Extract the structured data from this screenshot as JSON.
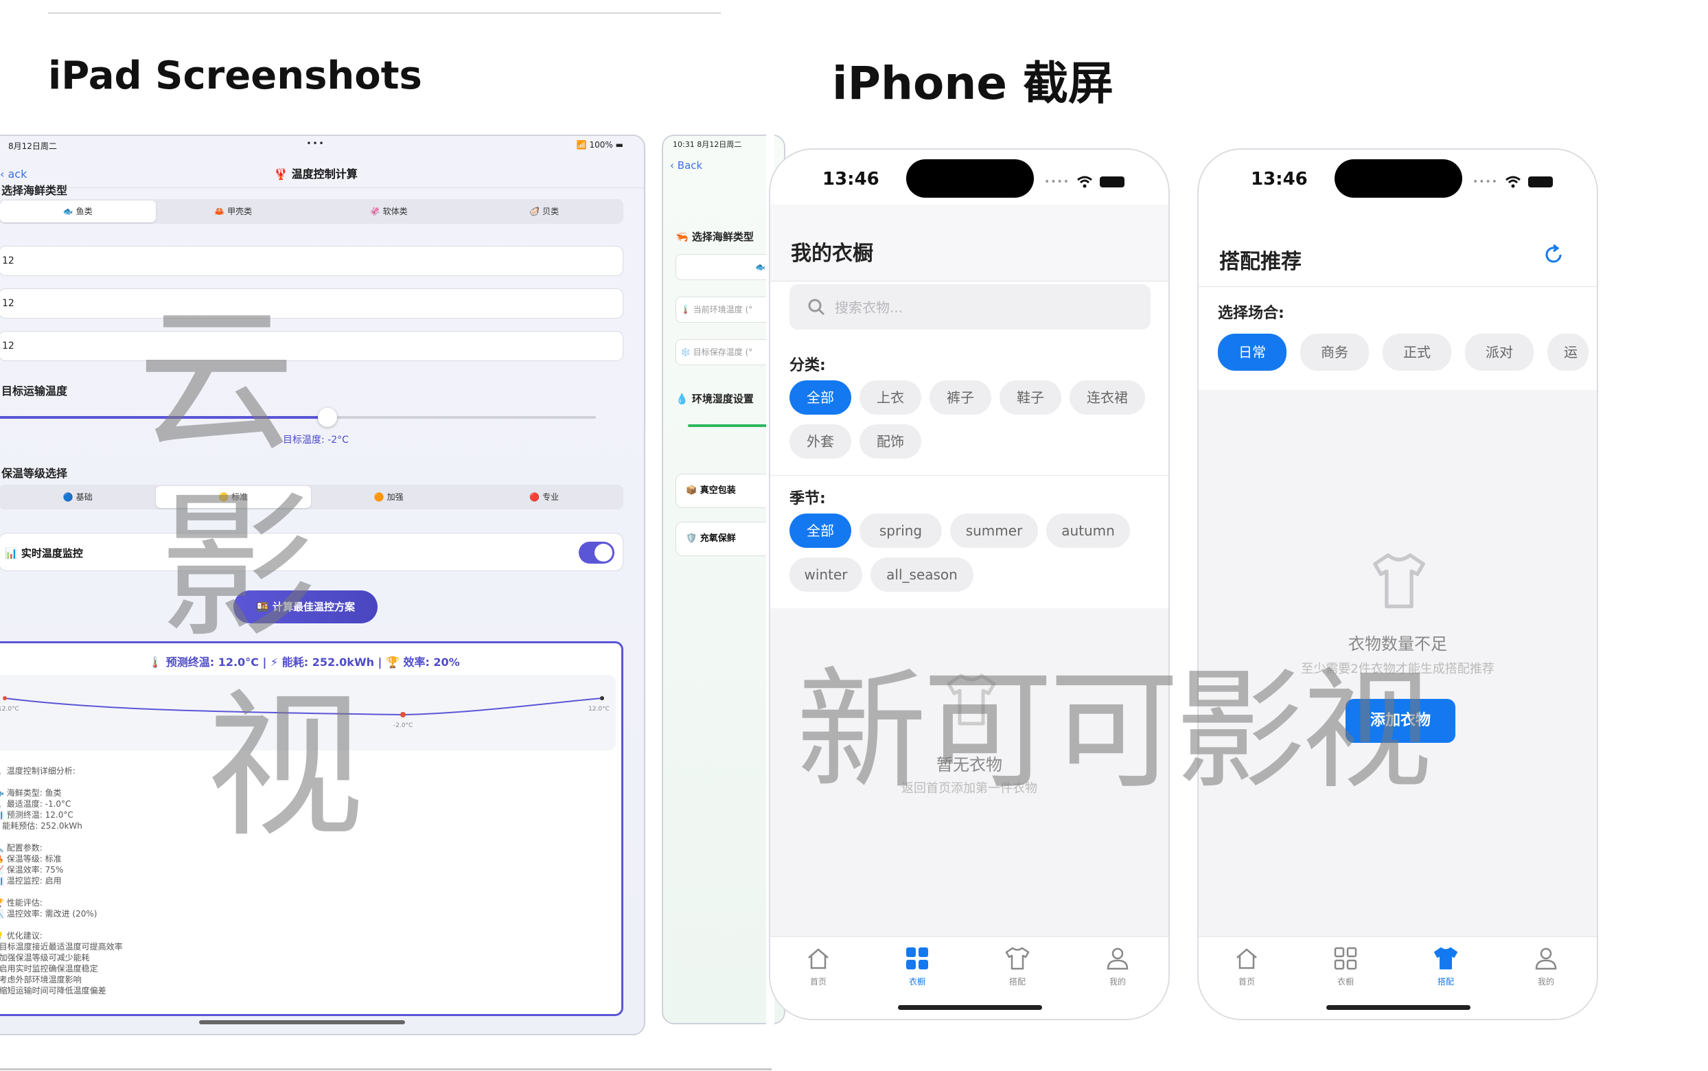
{
  "sections": {
    "ipad_title": "iPad Screenshots",
    "iphone_title": "iPhone 截屏"
  },
  "ipad_main": {
    "status_date": "8月12日周二",
    "status_right": "100%",
    "back_label": "ack",
    "nav_title": "🦞 温度控制计算",
    "species_label": "选择海鲜类型",
    "species_options": [
      "🐟 鱼类",
      "🦀 甲壳类",
      "🦑 软体类",
      "🦪 贝类"
    ],
    "inputs": [
      "12",
      "12",
      "12"
    ],
    "target_label": "目标运输温度",
    "target_caption": "目标温度: -2°C",
    "target_fraction": 0.55,
    "insulation_label": "保温等级选择",
    "insulation_options": [
      "🔵 基础",
      "🟡 标准",
      "🟠 加强",
      "🔴 专业"
    ],
    "monitor_label": "📊 实时温度监控",
    "calc_button": "🍱 计算最佳温控方案",
    "summary": "🌡️ 预测终温: 12.0°C | ⚡ 能耗: 252.0kWh | 🏆 效率: 20%",
    "chart_labels": [
      "12.0°C",
      "-2.0°C",
      "12.0°C"
    ],
    "analysis": [
      "🌡️ 温度控制详细分析:",
      "",
      "🐟 海鲜类型: 鱼类",
      "🌡️ 最适温度: -1.0°C",
      "📊 预测终温: 12.0°C",
      "⚡ 能耗预估: 252.0kWh",
      "",
      "🔧 配置参数:",
      "🔥 保温等级: 标准",
      "📈 保温效率: 75%",
      "📊 温控监控: 启用",
      "",
      "🏆 性能评估:",
      "📉 温控效率: 需改进 (20%)",
      "",
      "💡 优化建议:",
      "· 目标温度接近最适温度可提高效率",
      "· 加强保温等级可减少能耗",
      "· 启用实时监控确保温度稳定",
      "· 考虑外部环境温度影响",
      "· 缩短运输时间可降低温度偏差"
    ]
  },
  "ipad_partial": {
    "status": "10:31  8月12日周二",
    "back_label": "Back",
    "species_label": "🦐 选择海鲜类型",
    "species_selected": "🐟 鱼类",
    "env_temp_placeholder": "🌡️ 当前环境温度 (°",
    "target_temp_placeholder": "❄️ 目标保存温度 (°",
    "humidity_label": "💧 环境湿度设置",
    "options": [
      "📦 真空包装",
      "🛡️ 充氧保鲜"
    ]
  },
  "phone1": {
    "time": "13:46",
    "title": "我的衣橱",
    "search_placeholder": "搜索衣物...",
    "category_label": "分类:",
    "categories": [
      "全部",
      "上衣",
      "裤子",
      "鞋子",
      "连衣裙",
      "外套",
      "配饰"
    ],
    "season_label": "季节:",
    "seasons": [
      "全部",
      "spring",
      "summer",
      "autumn",
      "winter",
      "all_season"
    ],
    "empty_title": "暂无衣物",
    "empty_sub": "返回首页添加第一件衣物",
    "tabs": [
      "首页",
      "衣橱",
      "搭配",
      "我的"
    ],
    "active_tab": 1
  },
  "phone2": {
    "time": "13:46",
    "title": "搭配推荐",
    "occasion_label": "选择场合:",
    "occasions": [
      "日常",
      "商务",
      "正式",
      "派对",
      "运"
    ],
    "empty_title": "衣物数量不足",
    "empty_sub": "至少需要2件衣物才能生成搭配推荐",
    "add_button": "添加衣物",
    "tabs": [
      "首页",
      "衣橱",
      "搭配",
      "我的"
    ],
    "active_tab": 2
  },
  "watermarks": {
    "w1": "云",
    "w2": "影",
    "w3": "视",
    "w4": "新可可影视"
  },
  "colors": {
    "accent_purple": "#5b56d6",
    "accent_blue": "#1479f0"
  }
}
